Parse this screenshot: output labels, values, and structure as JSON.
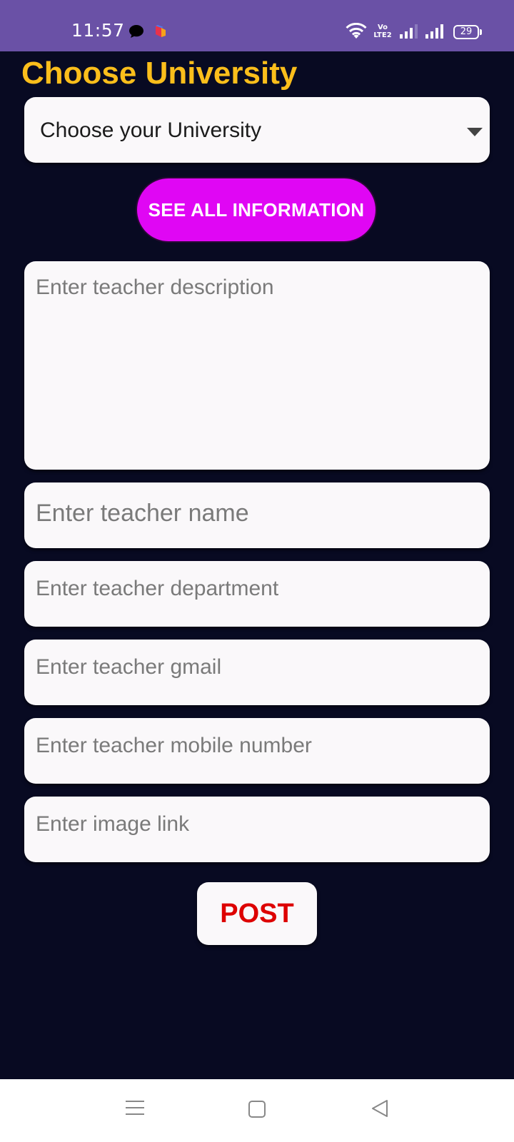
{
  "status_bar": {
    "time": "11:57",
    "volte_label": "Vo LTE2",
    "battery_level": "29",
    "icons": [
      "chat-bubble-icon",
      "notification-app-icon",
      "wifi-icon",
      "signal-icon",
      "signal-icon",
      "battery-icon"
    ]
  },
  "page": {
    "title": "Choose University"
  },
  "university_select": {
    "value": "Choose your University",
    "icon": "dropdown-arrow-icon"
  },
  "see_all_button": {
    "label": "SEE ALL INFORMATION",
    "color": "#e006f4"
  },
  "form": {
    "description_placeholder": "Enter teacher description",
    "name_placeholder": "Enter teacher name",
    "department_placeholder": "Enter teacher department",
    "gmail_placeholder": "Enter teacher gmail",
    "mobile_placeholder": "Enter teacher mobile number",
    "image_placeholder": "Enter image link"
  },
  "post_button": {
    "label": "POST",
    "color": "#dd0000"
  },
  "nav_bar": {
    "icons": [
      "menu-icon",
      "home-square-icon",
      "back-triangle-icon"
    ]
  },
  "colors": {
    "status_bar": "#6a51a6",
    "background": "#080a22",
    "title": "#fbbe1b",
    "field_bg": "#faf8fa"
  }
}
